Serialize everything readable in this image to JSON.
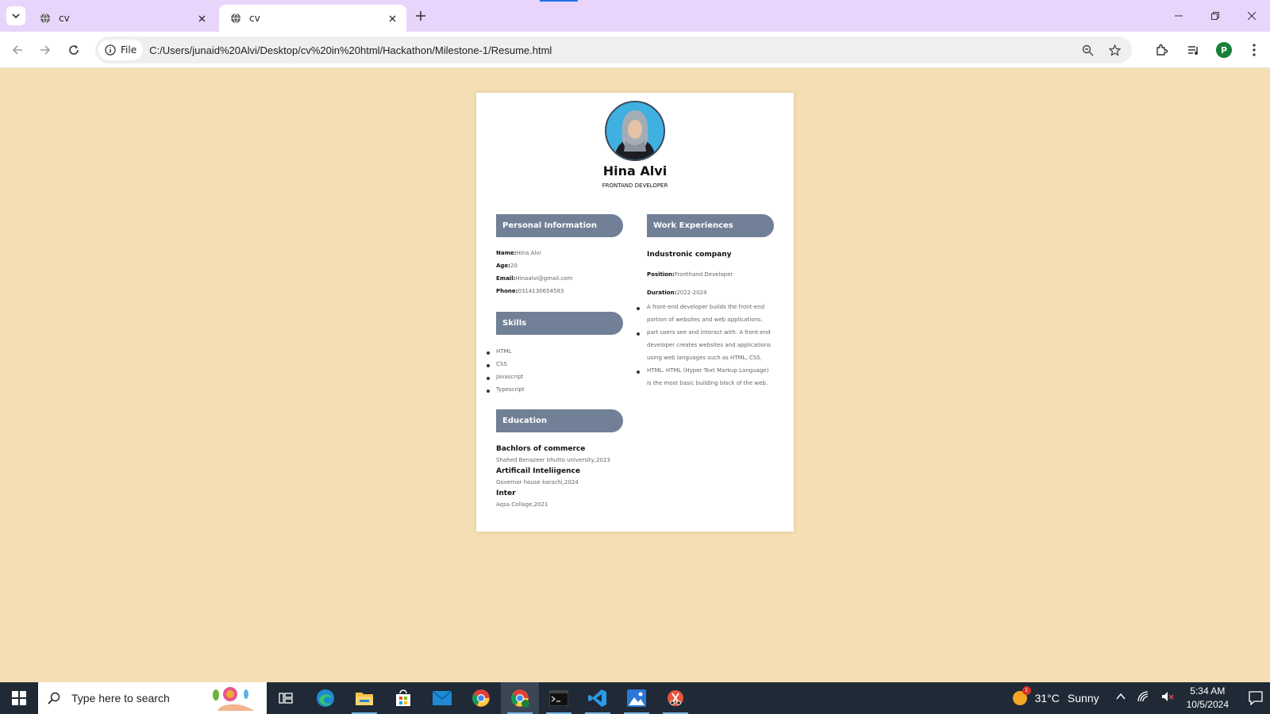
{
  "browser": {
    "tabs": [
      {
        "title": "cv",
        "active": false
      },
      {
        "title": "cv",
        "active": true
      }
    ],
    "file_chip": "File",
    "url": "C:/Users/junaid%20Alvi/Desktop/cv%20in%20html/Hackathon/Milestone-1/Resume.html",
    "profile_initial": "P"
  },
  "resume": {
    "name": "Hina Alvi",
    "role": "FRONTAND DEVELOPER",
    "personal": {
      "heading": "Personal Information",
      "fields": [
        {
          "label": "Name:",
          "value": "Hina Alvi"
        },
        {
          "label": "Age:",
          "value": "20"
        },
        {
          "label": "Email:",
          "value": "Hinaalvi@gmail.com"
        },
        {
          "label": "Phone:",
          "value": "0314130654583"
        }
      ]
    },
    "skills": {
      "heading": "Skills",
      "items": [
        "HTML",
        "CSS",
        "Javascript",
        "Typescript"
      ]
    },
    "education": {
      "heading": "Education",
      "items": [
        {
          "degree": "Bachlors of commerce",
          "institution": "Shahed Benazeer bhutto university,2023"
        },
        {
          "degree": "Artificail Inteliigence",
          "institution": "Governor house karachi,2024"
        },
        {
          "degree": "Inter",
          "institution": "Aqsa Collage,2021"
        }
      ]
    },
    "work": {
      "heading": "Work Experiences",
      "company": "Industronic company",
      "position_label": "Position:",
      "position": "Fronthand Developer",
      "duration_label": "Duration:",
      "duration": "2022-2024",
      "bullets": [
        "A front-end developer builds the front-end portion of websites and web applications.",
        "part users see and interact with. A front-end developer creates websites and applications using web languages such as HTML, CSS.",
        "HTML. HTML (Hyper Text Markup Language) is the most basic building block of the web."
      ]
    }
  },
  "taskbar": {
    "search_placeholder": "Type here to search",
    "weather_temp": "31°C",
    "weather_desc": "Sunny",
    "weather_badge": "1",
    "time": "5:34 AM",
    "date": "10/5/2024"
  }
}
